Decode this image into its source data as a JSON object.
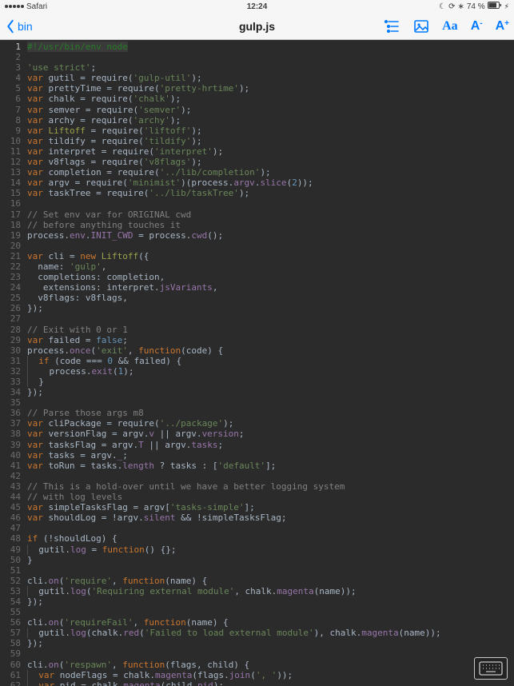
{
  "status": {
    "carrier_back": "Safari",
    "time": "12:24",
    "bt": "74 %",
    "icons": {
      "moon": "moon-icon",
      "rot": "rotation-lock-icon",
      "bt_glyph": "bluetooth-icon",
      "bat": "battery-charging-icon"
    }
  },
  "toolbar": {
    "back_label": "bin",
    "title": "gulp.js",
    "tools": {
      "list": "outline-list-icon",
      "image": "image-icon",
      "font": "Aa",
      "smaller": "A-",
      "bigger": "A+"
    }
  },
  "keyboard_btn": "keyboard-icon",
  "code": {
    "indent": "  ",
    "lines": [
      {
        "n": 1,
        "t": "shebang",
        "txt": "#!/usr/bin/env node"
      },
      {
        "n": 2,
        "t": "blank"
      },
      {
        "n": 3,
        "t": "stmt",
        "segs": [
          [
            "str",
            "'use strict'"
          ],
          [
            "def",
            ";"
          ]
        ]
      },
      {
        "n": 4,
        "t": "req",
        "v": "gutil",
        "m": "gulp-util"
      },
      {
        "n": 5,
        "t": "req",
        "v": "prettyTime",
        "m": "pretty-hrtime"
      },
      {
        "n": 6,
        "t": "req",
        "v": "chalk",
        "m": "chalk"
      },
      {
        "n": 7,
        "t": "req",
        "v": "semver",
        "m": "semver"
      },
      {
        "n": 8,
        "t": "req",
        "v": "archy",
        "m": "archy"
      },
      {
        "n": 9,
        "t": "req",
        "v": "Liftoff",
        "m": "liftoff",
        "vstyle": "type"
      },
      {
        "n": 10,
        "t": "req",
        "v": "tildify",
        "m": "tildify"
      },
      {
        "n": 11,
        "t": "req",
        "v": "interpret",
        "m": "interpret"
      },
      {
        "n": 12,
        "t": "req",
        "v": "v8flags",
        "m": "v8flags"
      },
      {
        "n": 13,
        "t": "req",
        "v": "completion",
        "m": "../lib/completion"
      },
      {
        "n": 14,
        "t": "raw",
        "segs": [
          [
            "kw",
            "var"
          ],
          [
            "def",
            " argv = require("
          ],
          [
            "str",
            "'minimist'"
          ],
          [
            "def",
            ")(process."
          ],
          [
            "prop",
            "argv"
          ],
          [
            "def",
            "."
          ],
          [
            "prop",
            "slice"
          ],
          [
            "def",
            "("
          ],
          [
            "num",
            "2"
          ],
          [
            "def",
            "));"
          ]
        ]
      },
      {
        "n": 15,
        "t": "req",
        "v": "taskTree",
        "m": "../lib/taskTree"
      },
      {
        "n": 16,
        "t": "blank"
      },
      {
        "n": 17,
        "t": "cmt",
        "txt": "// Set env var for ORIGINAL cwd"
      },
      {
        "n": 18,
        "t": "cmt",
        "txt": "// before anything touches it"
      },
      {
        "n": 19,
        "t": "raw",
        "segs": [
          [
            "def",
            "process."
          ],
          [
            "prop",
            "env"
          ],
          [
            "def",
            "."
          ],
          [
            "prop",
            "INIT_CWD"
          ],
          [
            "def",
            " = process."
          ],
          [
            "prop",
            "cwd"
          ],
          [
            "def",
            "();"
          ]
        ]
      },
      {
        "n": 20,
        "t": "blank"
      },
      {
        "n": 21,
        "t": "raw",
        "segs": [
          [
            "kw",
            "var"
          ],
          [
            "def",
            " cli = "
          ],
          [
            "kw",
            "new"
          ],
          [
            "def",
            " "
          ],
          [
            "type",
            "Liftoff"
          ],
          [
            "def",
            "({"
          ]
        ]
      },
      {
        "n": 22,
        "t": "raw",
        "indent": 1,
        "segs": [
          [
            "def",
            "name: "
          ],
          [
            "str",
            "'gulp'"
          ],
          [
            "def",
            ","
          ]
        ]
      },
      {
        "n": 23,
        "t": "raw",
        "indent": 1,
        "segs": [
          [
            "def",
            "completions: completion,"
          ]
        ]
      },
      {
        "n": 24,
        "t": "raw",
        "indent": 1,
        "segs": [
          [
            "def",
            " extensions: interpret."
          ],
          [
            "prop",
            "jsVariants"
          ],
          [
            "def",
            ","
          ]
        ]
      },
      {
        "n": 25,
        "t": "raw",
        "indent": 1,
        "segs": [
          [
            "def",
            "v8flags: v8flags,"
          ]
        ]
      },
      {
        "n": 26,
        "t": "raw",
        "segs": [
          [
            "def",
            "});"
          ]
        ]
      },
      {
        "n": 27,
        "t": "blank"
      },
      {
        "n": 28,
        "t": "cmt",
        "txt": "// Exit with 0 or 1"
      },
      {
        "n": 29,
        "t": "raw",
        "segs": [
          [
            "kw",
            "var"
          ],
          [
            "def",
            " failed = "
          ],
          [
            "num",
            "false"
          ],
          [
            "def",
            ";"
          ]
        ]
      },
      {
        "n": 30,
        "t": "raw",
        "segs": [
          [
            "def",
            "process."
          ],
          [
            "prop",
            "once"
          ],
          [
            "def",
            "("
          ],
          [
            "str",
            "'exit'"
          ],
          [
            "def",
            ", "
          ],
          [
            "kw",
            "function"
          ],
          [
            "def",
            "(code) {"
          ]
        ]
      },
      {
        "n": 31,
        "t": "raw",
        "indent": 1,
        "guide": 1,
        "segs": [
          [
            "kw",
            "if"
          ],
          [
            "def",
            " (code === "
          ],
          [
            "num",
            "0"
          ],
          [
            "def",
            " && failed) {"
          ]
        ]
      },
      {
        "n": 32,
        "t": "raw",
        "indent": 2,
        "guide": 1,
        "segs": [
          [
            "def",
            "process."
          ],
          [
            "prop",
            "exit"
          ],
          [
            "def",
            "("
          ],
          [
            "num",
            "1"
          ],
          [
            "def",
            ");"
          ]
        ]
      },
      {
        "n": 33,
        "t": "raw",
        "indent": 1,
        "guide": 1,
        "segs": [
          [
            "def",
            "}"
          ]
        ]
      },
      {
        "n": 34,
        "t": "raw",
        "segs": [
          [
            "def",
            "});"
          ]
        ]
      },
      {
        "n": 35,
        "t": "blank"
      },
      {
        "n": 36,
        "t": "cmt",
        "txt": "// Parse those args m8"
      },
      {
        "n": 37,
        "t": "req",
        "v": "cliPackage",
        "m": "../package"
      },
      {
        "n": 38,
        "t": "raw",
        "segs": [
          [
            "kw",
            "var"
          ],
          [
            "def",
            " versionFlag = argv."
          ],
          [
            "prop",
            "v"
          ],
          [
            "def",
            " || argv."
          ],
          [
            "prop",
            "version"
          ],
          [
            "def",
            ";"
          ]
        ]
      },
      {
        "n": 39,
        "t": "raw",
        "segs": [
          [
            "kw",
            "var"
          ],
          [
            "def",
            " tasksFlag = argv."
          ],
          [
            "prop",
            "T"
          ],
          [
            "def",
            " || argv."
          ],
          [
            "prop",
            "tasks"
          ],
          [
            "def",
            ";"
          ]
        ]
      },
      {
        "n": 40,
        "t": "raw",
        "segs": [
          [
            "kw",
            "var"
          ],
          [
            "def",
            " tasks = argv."
          ],
          [
            "prop",
            "_"
          ],
          [
            "def",
            ";"
          ]
        ]
      },
      {
        "n": 41,
        "t": "raw",
        "segs": [
          [
            "kw",
            "var"
          ],
          [
            "def",
            " toRun = tasks."
          ],
          [
            "prop",
            "length"
          ],
          [
            "def",
            " ? tasks : ["
          ],
          [
            "str",
            "'default'"
          ],
          [
            "def",
            "];"
          ]
        ]
      },
      {
        "n": 42,
        "t": "blank"
      },
      {
        "n": 43,
        "t": "cmt",
        "txt": "// This is a hold-over until we have a better logging system"
      },
      {
        "n": 44,
        "t": "cmt",
        "txt": "// with log levels"
      },
      {
        "n": 45,
        "t": "raw",
        "segs": [
          [
            "kw",
            "var"
          ],
          [
            "def",
            " simpleTasksFlag = argv["
          ],
          [
            "str",
            "'tasks-simple'"
          ],
          [
            "def",
            "];"
          ]
        ]
      },
      {
        "n": 46,
        "t": "raw",
        "segs": [
          [
            "kw",
            "var"
          ],
          [
            "def",
            " shouldLog = !argv."
          ],
          [
            "prop",
            "silent"
          ],
          [
            "def",
            " && !simpleTasksFlag;"
          ]
        ]
      },
      {
        "n": 47,
        "t": "blank"
      },
      {
        "n": 48,
        "t": "raw",
        "segs": [
          [
            "kw",
            "if"
          ],
          [
            "def",
            " (!shouldLog) {"
          ]
        ]
      },
      {
        "n": 49,
        "t": "raw",
        "indent": 1,
        "guide": 1,
        "segs": [
          [
            "def",
            "gutil."
          ],
          [
            "prop",
            "log"
          ],
          [
            "def",
            " = "
          ],
          [
            "kw",
            "function"
          ],
          [
            "def",
            "() {};"
          ]
        ]
      },
      {
        "n": 50,
        "t": "raw",
        "segs": [
          [
            "def",
            "}"
          ]
        ]
      },
      {
        "n": 51,
        "t": "blank"
      },
      {
        "n": 52,
        "t": "raw",
        "segs": [
          [
            "def",
            "cli."
          ],
          [
            "prop",
            "on"
          ],
          [
            "def",
            "("
          ],
          [
            "str",
            "'require'"
          ],
          [
            "def",
            ", "
          ],
          [
            "kw",
            "function"
          ],
          [
            "def",
            "(name) {"
          ]
        ]
      },
      {
        "n": 53,
        "t": "raw",
        "indent": 1,
        "guide": 1,
        "segs": [
          [
            "def",
            "gutil."
          ],
          [
            "prop",
            "log"
          ],
          [
            "def",
            "("
          ],
          [
            "str",
            "'Requiring external module'"
          ],
          [
            "def",
            ", chalk."
          ],
          [
            "prop",
            "magenta"
          ],
          [
            "def",
            "(name));"
          ]
        ]
      },
      {
        "n": 54,
        "t": "raw",
        "segs": [
          [
            "def",
            "});"
          ]
        ]
      },
      {
        "n": 55,
        "t": "blank"
      },
      {
        "n": 56,
        "t": "raw",
        "segs": [
          [
            "def",
            "cli."
          ],
          [
            "prop",
            "on"
          ],
          [
            "def",
            "("
          ],
          [
            "str",
            "'requireFail'"
          ],
          [
            "def",
            ", "
          ],
          [
            "kw",
            "function"
          ],
          [
            "def",
            "(name) {"
          ]
        ]
      },
      {
        "n": 57,
        "t": "raw",
        "indent": 1,
        "guide": 1,
        "segs": [
          [
            "def",
            "gutil."
          ],
          [
            "prop",
            "log"
          ],
          [
            "def",
            "(chalk."
          ],
          [
            "prop",
            "red"
          ],
          [
            "def",
            "("
          ],
          [
            "str",
            "'Failed to load external module'"
          ],
          [
            "def",
            "), chalk."
          ],
          [
            "prop",
            "magenta"
          ],
          [
            "def",
            "(name));"
          ]
        ]
      },
      {
        "n": 58,
        "t": "raw",
        "segs": [
          [
            "def",
            "});"
          ]
        ]
      },
      {
        "n": 59,
        "t": "blank"
      },
      {
        "n": 60,
        "t": "raw",
        "segs": [
          [
            "def",
            "cli."
          ],
          [
            "prop",
            "on"
          ],
          [
            "def",
            "("
          ],
          [
            "str",
            "'respawn'"
          ],
          [
            "def",
            ", "
          ],
          [
            "kw",
            "function"
          ],
          [
            "def",
            "(flags, child) {"
          ]
        ]
      },
      {
        "n": 61,
        "t": "raw",
        "indent": 1,
        "guide": 1,
        "segs": [
          [
            "kw",
            "var"
          ],
          [
            "def",
            " nodeFlags = chalk."
          ],
          [
            "prop",
            "magenta"
          ],
          [
            "def",
            "(flags."
          ],
          [
            "prop",
            "join"
          ],
          [
            "def",
            "("
          ],
          [
            "str",
            "', '"
          ],
          [
            "def",
            "));"
          ]
        ]
      },
      {
        "n": 62,
        "t": "raw",
        "indent": 1,
        "guide": 1,
        "segs": [
          [
            "kw",
            "var"
          ],
          [
            "def",
            " pid = chalk."
          ],
          [
            "prop",
            "magenta"
          ],
          [
            "def",
            "(child."
          ],
          [
            "prop",
            "pid"
          ],
          [
            "def",
            ");"
          ]
        ]
      }
    ]
  }
}
